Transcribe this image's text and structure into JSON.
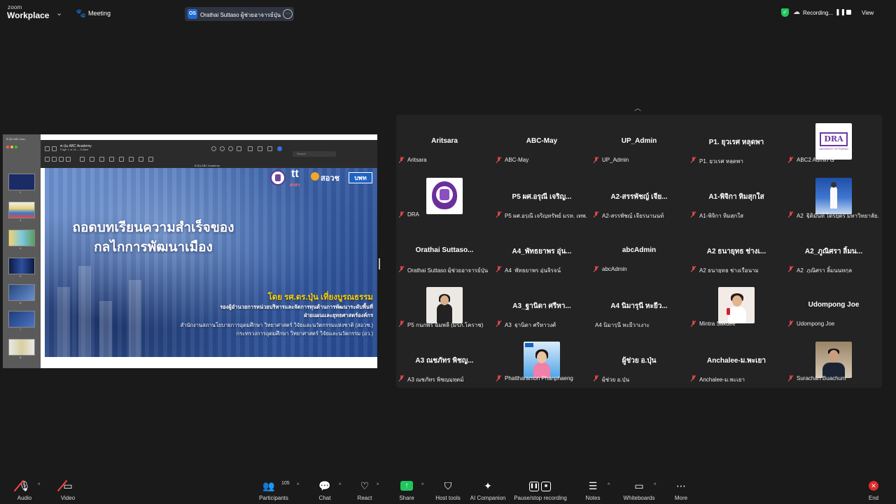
{
  "topbar": {
    "brand_zoom": "zoom",
    "brand_workplace": "Workplace",
    "meeting_label": "Meeting",
    "speaker_initials": "OS",
    "speaker_name": "Orathai Suttaso  ผู้ช่วยอาจารย์ปุ่น's :",
    "recording_label": "Recording...",
    "view_label": "View",
    "colors": {
      "bg": "#1a1a1a",
      "badge": "#1f6ad9",
      "secure": "#22c55e"
    }
  },
  "share": {
    "window_title": "ศ.ปุ่น ABC Academy",
    "window_subtitle": "Page 1 of 16 — Edited",
    "tab_label": "ศ.ปุ่น ABC Academy",
    "search_placeholder": "Search",
    "sidebar_title": "ศ.ปุ่น ABC Aca...",
    "thumbnail_numbers": [
      "",
      "2",
      "3",
      "4",
      "5",
      "6",
      "7",
      "8",
      "9"
    ],
    "slide": {
      "title_line1": "ถอดบทเรียนความสำเร็จของ",
      "title_line2": "กลไกการพัฒนาเมือง",
      "logo_tt_sub": "สกสว",
      "logo_sawor": "สอวช",
      "logo_bpt": "บพท",
      "by_line": "โดย รศ.ดร.ปุ่น เที่ยงบูรณธรรม",
      "line1": "รองผู้อำนวยการหน่วยบริหารและจัดการทุนด้านการพัฒนาระดับพื้นที่",
      "line2": "ฝ่ายแผนและยุทธศาสตร์องค์กร",
      "line3": "สำนักงานสภานโยบายการอุดมศึกษา วิทยาศาสตร์ วิจัยและนวัตกรรมแห่งชาติ (สอวช.)",
      "line4": "กระทรวงการอุดมศึกษา วิทยาศาสตร์ วิจัยและนวัตกรรม (อว.)"
    }
  },
  "gallery": {
    "participants": [
      {
        "name": "Aritsara",
        "label": "Aritsara",
        "avatar": "",
        "muted": true
      },
      {
        "name": "ABC-May",
        "label": "ABC-May",
        "avatar": "",
        "muted": true
      },
      {
        "name": "UP_Admin",
        "label": "UP_Admin",
        "avatar": "",
        "muted": true
      },
      {
        "name": "P1. ยุวเรศ หลุดพา",
        "label": "P1. ยุวเรศ หลุดพา",
        "avatar": "",
        "muted": true
      },
      {
        "name": "",
        "label": "ABC2 Admin G",
        "avatar": "dra-logo",
        "muted": true
      },
      {
        "name": "",
        "label": "DRA",
        "avatar": "seal-logo",
        "muted": true
      },
      {
        "name": "P5 ผศ.อรุณี เจริญ...",
        "label": "P5 ผศ.อรุณี เจริญทรัพย์ มรท. เทพ...",
        "avatar": "",
        "muted": true
      },
      {
        "name": "A2-สรรพัชญ์ เจีย...",
        "label": "A2-สรรพัชญ์ เจียรนานนท์",
        "avatar": "",
        "muted": true
      },
      {
        "name": "A1-พิจิกา หิมสุกใส",
        "label": "A1-พิจิกา หิมสุกใส",
        "avatar": "",
        "muted": true
      },
      {
        "name": "",
        "label": "A2_ฐิติมันท์ ไตรยุตร มหาวิทยาลัย...",
        "avatar": "banner-photo",
        "muted": true
      },
      {
        "name": "Orathai  Suttaso...",
        "label": "Orathai Suttaso  ผู้ช่วยอาจารย์ปุ่น",
        "avatar": "",
        "muted": true
      },
      {
        "name": "A4_พัทธยาพร อุ่น...",
        "label": "A4_พัทธยาพร อุ่นจิรจน์",
        "avatar": "",
        "muted": true
      },
      {
        "name": "abcAdmin",
        "label": "abcAdmin",
        "avatar": "",
        "muted": true
      },
      {
        "name": "A2 ธนายุทธ ช่างเ...",
        "label": "A2 ธนายุทธ ช่างเรือนาม",
        "avatar": "",
        "muted": true
      },
      {
        "name": "A2_ภูณิศรา ลิ้มน...",
        "label": "A2_ภูณิศรา ลิ้มนนทกุล",
        "avatar": "",
        "muted": true
      },
      {
        "name": "",
        "label": "P5 กนกพร ฉิมพลี (มรภ.โคราช)",
        "avatar": "woman-photo",
        "muted": true
      },
      {
        "name": "A3_ฐานิดา ศรีหา...",
        "label": "A3_ฐานิดา ศรีหาวงศ์",
        "avatar": "",
        "muted": true
      },
      {
        "name": "A4 นิมารุนี หะยีว...",
        "label": "A4 นิมารุนี หะยีวาเงาะ",
        "avatar": "",
        "muted": false
      },
      {
        "name": "",
        "label": "Mintra Sakdee",
        "avatar": "mic-photo",
        "muted": true
      },
      {
        "name": "Udompong Joe",
        "label": "Udompong Joe",
        "avatar": "",
        "muted": true
      },
      {
        "name": "A3 ณชภัทร พิชญ...",
        "label": "A3 ณชภัทร พิชญมุทุตม์",
        "avatar": "",
        "muted": true
      },
      {
        "name": "",
        "label": "Phattharamon Phanphaeng",
        "avatar": "phat-photo",
        "muted": true
      },
      {
        "name": "ผู้ช่วย อ.ปุ่น",
        "label": "ผู้ช่วย อ.ปุ่น",
        "avatar": "",
        "muted": true
      },
      {
        "name": "Anchalee-ม.พะเยา",
        "label": "Anchalee-ม.พะเยา",
        "avatar": "",
        "muted": true
      },
      {
        "name": "",
        "label": "Surachart Buachum",
        "avatar": "sura-photo",
        "muted": true
      }
    ],
    "dra_logo_text": "DRA",
    "dra_logo_sub": "UNIVERSITY OF PHAYAO"
  },
  "toolbar": {
    "audio": "Audio",
    "video": "Video",
    "participants": "Participants",
    "participant_count": "105",
    "chat": "Chat",
    "react": "React",
    "share": "Share",
    "host_tools": "Host tools",
    "ai_companion": "AI Companion",
    "pause_stop": "Pause/stop recording",
    "notes": "Notes",
    "whiteboards": "Whiteboards",
    "more": "More",
    "end": "End",
    "colors": {
      "share": "#22c55e",
      "end": "#e02a2a",
      "muted": "#ff4444"
    }
  }
}
